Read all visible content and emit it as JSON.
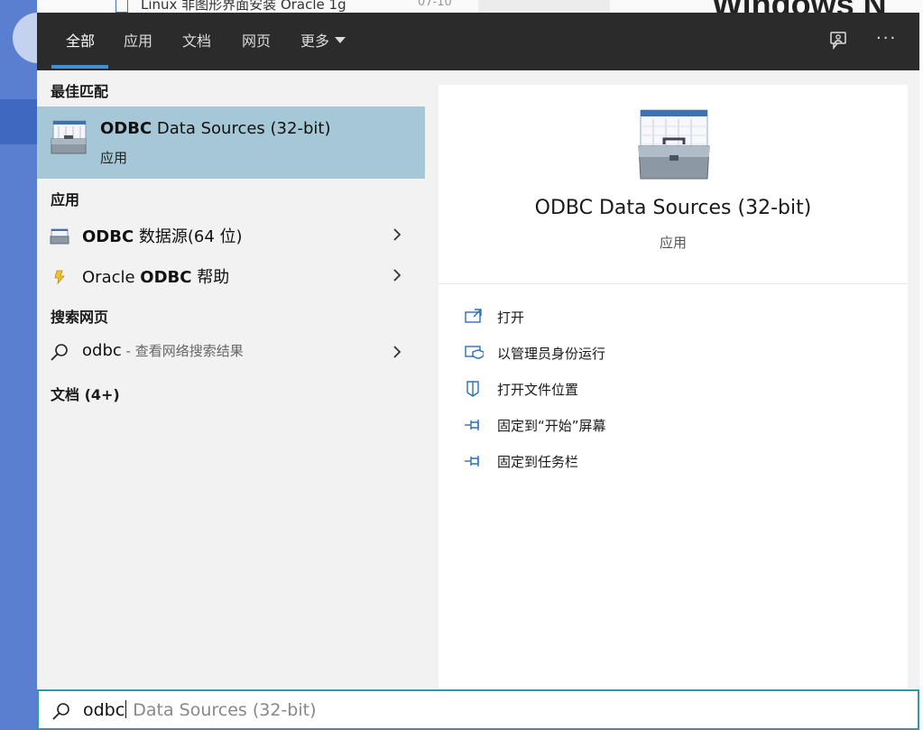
{
  "background": {
    "doc_title": "Linux 非图形界面安装 Oracle 1g",
    "doc_date": "07-10",
    "page_title": "Windows N"
  },
  "tabs": [
    {
      "label": "全部",
      "active": true
    },
    {
      "label": "应用",
      "active": false
    },
    {
      "label": "文档",
      "active": false
    },
    {
      "label": "网页",
      "active": false
    },
    {
      "label": "更多",
      "active": false
    }
  ],
  "toolbar": {
    "more_icon": "···"
  },
  "left": {
    "best_match_heading": "最佳匹配",
    "best_match": {
      "title_bold": "ODBC",
      "title_rest": " Data Sources (32-bit)",
      "subtitle": "应用"
    },
    "apps_heading": "应用",
    "apps": [
      {
        "bold": "ODBC",
        "rest": " 数据源(64 位)",
        "prefix": ""
      },
      {
        "prefix": "Oracle ",
        "bold": "ODBC",
        "rest": " 帮助"
      }
    ],
    "web_heading": "搜索网页",
    "web_result": {
      "query": "odbc",
      "hint": " - 查看网络搜索结果"
    },
    "docs_heading": "文档 (4+)"
  },
  "detail": {
    "name": "ODBC Data Sources (32-bit)",
    "kind": "应用",
    "actions": [
      {
        "label": "打开",
        "icon": "open-icon"
      },
      {
        "label": "以管理员身份运行",
        "icon": "run-as-admin-icon"
      },
      {
        "label": "打开文件位置",
        "icon": "file-location-icon"
      },
      {
        "label": "固定到“开始”屏幕",
        "icon": "pin-start-icon"
      },
      {
        "label": "固定到任务栏",
        "icon": "pin-taskbar-icon"
      }
    ]
  },
  "search": {
    "typed": "odbc",
    "completion": " Data Sources (32-bit)"
  },
  "colors": {
    "accent": "#3d8fd6",
    "selected": "#a6c8d6",
    "topbar": "#2b2b2b",
    "search_border": "#2e9aa8"
  }
}
